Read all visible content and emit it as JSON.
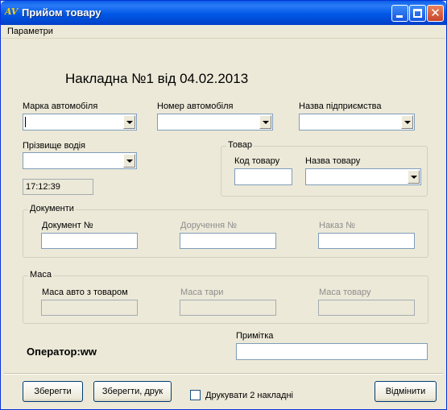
{
  "window": {
    "title": "Прийом товару",
    "icon_text": "AV",
    "icon": "app-icon"
  },
  "menu": {
    "items": [
      "Параметри"
    ]
  },
  "invoice_heading": "Накладна №1 від 04.02.2013",
  "fields": {
    "car_brand_label": "Марка автомобіля",
    "car_number_label": "Номер автомобіля",
    "company_label": "Назва підприємства",
    "driver_label": "Прізвище водія",
    "time_value": "17:12:39"
  },
  "goods": {
    "legend": "Товар",
    "code_label": "Код товару",
    "name_label": "Назва товару"
  },
  "documents": {
    "legend": "Документи",
    "document_label": "Документ №",
    "assignment_label": "Доручення №",
    "order_label": "Наказ №"
  },
  "mass": {
    "legend": "Маса",
    "gross_label": "Маса авто з товаром",
    "tare_label": "Маса тари",
    "net_label": "Маса товару"
  },
  "note_label": "Примітка",
  "operator_text": "Оператор:ww",
  "buttons": {
    "save": "Зберегти",
    "save_print": "Зберегти, друк",
    "print_two_label": "Друкувати 2 накладні",
    "cancel": "Відмінити"
  }
}
